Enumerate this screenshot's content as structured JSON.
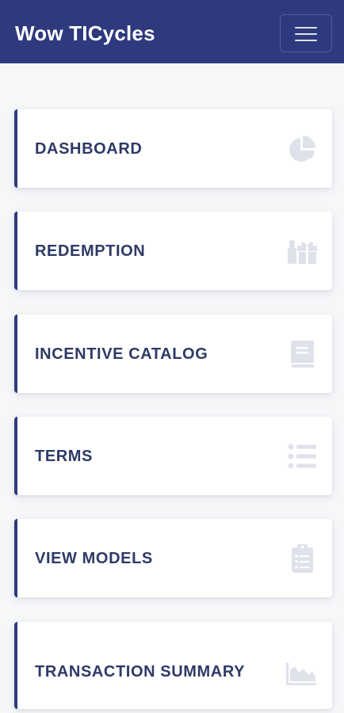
{
  "app": {
    "brand": "Wow TICycles",
    "accent_color": "#2e3a7d",
    "menu_toggle_icon": "hamburger-icon"
  },
  "menu": {
    "items": [
      {
        "label": "DASHBOARD",
        "icon": "pie-chart-icon"
      },
      {
        "label": "REDEMPTION",
        "icon": "gift-icon"
      },
      {
        "label": "INCENTIVE CATALOG",
        "icon": "book-icon"
      },
      {
        "label": "TERMS",
        "icon": "list-icon"
      },
      {
        "label": "VIEW MODELS",
        "icon": "clipboard-list-icon"
      },
      {
        "label": "TRANSACTION SUMMARY",
        "icon": "area-chart-icon"
      }
    ]
  }
}
